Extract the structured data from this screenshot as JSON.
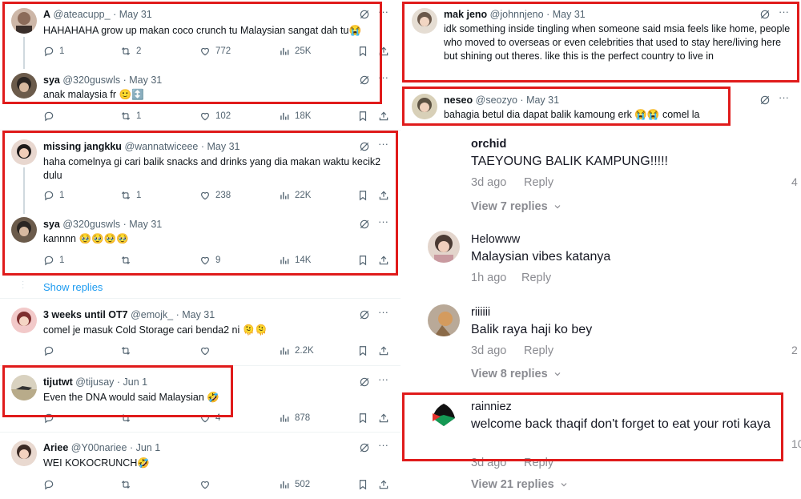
{
  "left_tweets": [
    {
      "name": "A",
      "handle": "@ateacupp_",
      "date": "May 31",
      "text": "HAHAHAHA grow up makan coco crunch tu Malaysian sangat dah tu😭",
      "replies": "1",
      "reposts": "2",
      "likes": "772",
      "views": "25K"
    },
    {
      "name": "sya",
      "handle": "@320guswls",
      "date": "May 31",
      "text": "anak malaysia fr 🙂↕️",
      "replies": "",
      "reposts": "1",
      "likes": "102",
      "views": "18K"
    },
    {
      "name": "missing jangkku",
      "handle": "@wannatwiceee",
      "date": "May 31",
      "text": "haha comelnya gi cari balik snacks and drinks yang dia makan waktu kecik2 dulu",
      "replies": "1",
      "reposts": "1",
      "likes": "238",
      "views": "22K"
    },
    {
      "name": "sya",
      "handle": "@320guswls",
      "date": "May 31",
      "text": "kannnn 🥹🥹🥹🥹",
      "replies": "1",
      "reposts": "",
      "likes": "9",
      "views": "14K"
    },
    {
      "name": "3 weeks until OT7",
      "handle": "@emojk_",
      "date": "May 31",
      "text": "comel je masuk Cold Storage cari benda2 ni 🫠🫠",
      "replies": "",
      "reposts": "",
      "likes": "",
      "views": "2.2K"
    },
    {
      "name": "tijutwt",
      "handle": "@tijusay",
      "date": "Jun 1",
      "text": "Even the DNA would said Malaysian 🤣",
      "replies": "",
      "reposts": "",
      "likes": "4",
      "views": "878"
    },
    {
      "name": "Ariee",
      "handle": "@Y00nariee",
      "date": "Jun 1",
      "text": "WEI KOKOCRUNCH🤣",
      "replies": "",
      "reposts": "",
      "likes": "",
      "views": "502"
    }
  ],
  "show_replies": "Show replies",
  "right_tweets": [
    {
      "name": "mak jeno",
      "handle": "@johnnjeno",
      "date": "May 31",
      "text": "idk something inside tingling when someone said msia feels like home, people who moved to overseas or even celebrities that used to stay here/living here but shining out theres. like this is the perfect country to live in"
    },
    {
      "name": "neseo",
      "handle": "@seozyo",
      "date": "May 31",
      "text": "bahagia betul dia dapat balik kamoung erk 😭😭 comel la"
    }
  ],
  "comments": [
    {
      "user": "orchid",
      "text": "TAEYOUNG BALIK KAMPUNG!!!!!",
      "age": "3d ago",
      "reply": "Reply",
      "view": "View 7 replies",
      "edge": "4"
    },
    {
      "user": "Helowww",
      "text": "Malaysian vibes katanya",
      "age": "1h ago",
      "reply": "Reply",
      "view": "",
      "edge": ""
    },
    {
      "user": "riiiiii",
      "text": "Balik raya haji ko bey",
      "age": "3d ago",
      "reply": "Reply",
      "view": "View 8 replies",
      "edge": "2"
    },
    {
      "user": "rainniez",
      "text": "welcome back thaqif don't forget to eat your roti kaya",
      "age": "3d ago",
      "reply": "Reply",
      "view": "View 21 replies",
      "edge": "10"
    }
  ],
  "icons": {
    "reply": "reply-icon",
    "repost": "repost-icon",
    "like": "heart-icon",
    "views": "views-icon",
    "bookmark": "bookmark-icon",
    "share": "share-icon",
    "grok": "grok-icon",
    "more": "more-icon",
    "chevron": "chevron-down-icon"
  },
  "colors": {
    "highlight": "#e01b1b",
    "link": "#1d9bf0",
    "muted": "#536471"
  }
}
